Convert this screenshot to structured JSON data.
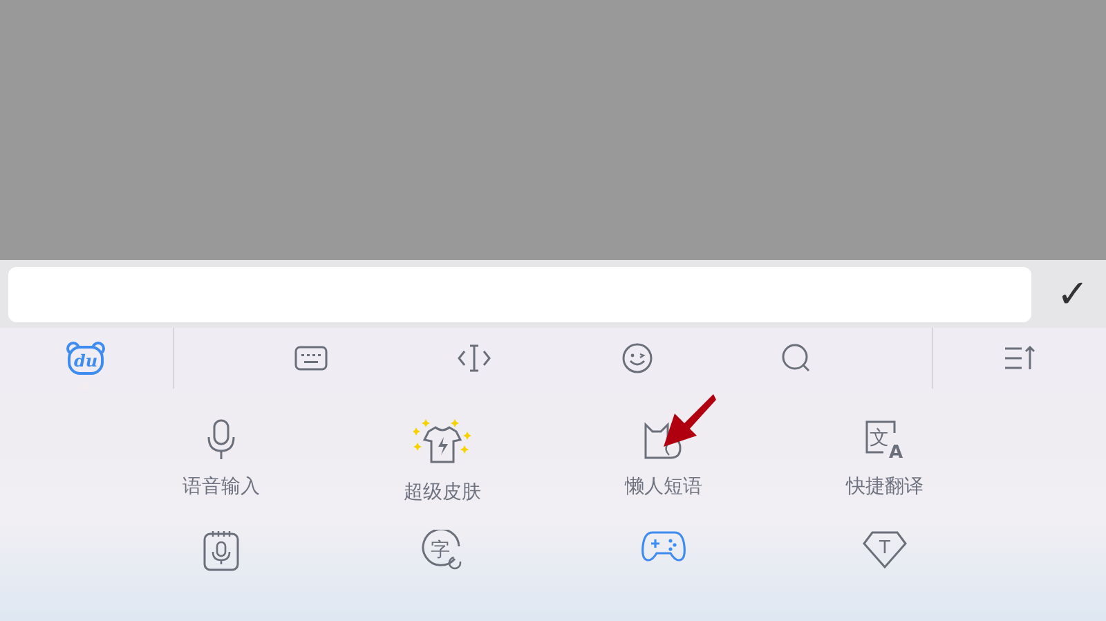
{
  "input_bar": {
    "confirm": "✓"
  },
  "toolbar": {
    "items": [
      {
        "kind": "logo",
        "glyph": "du",
        "selected": true
      },
      {
        "kind": "keyboard",
        "selected": false
      },
      {
        "kind": "cursor",
        "selected": false
      },
      {
        "kind": "emoji",
        "selected": false
      },
      {
        "kind": "search",
        "selected": false
      },
      {
        "kind": "collapse",
        "selected": false
      }
    ]
  },
  "grid": {
    "items": [
      {
        "kind": "mic",
        "label": "语音输入"
      },
      {
        "kind": "skin",
        "label": "超级皮肤"
      },
      {
        "kind": "cat",
        "label": "懒人短语"
      },
      {
        "kind": "translate",
        "label": "快捷翻译",
        "glyph": "文",
        "glyph_2": "A"
      },
      {
        "kind": "note"
      },
      {
        "kind": "char",
        "glyph": "字"
      },
      {
        "kind": "game"
      },
      {
        "kind": "diamond",
        "glyph": "T"
      }
    ]
  },
  "annotation": {
    "kind": "arrow"
  }
}
